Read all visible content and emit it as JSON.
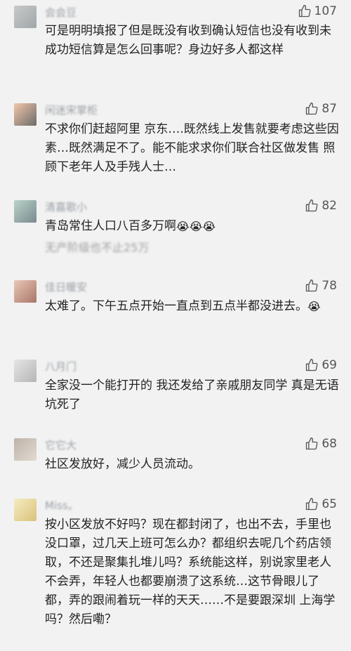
{
  "comments": [
    {
      "username": "会会豆",
      "likes": "107",
      "text": "可是明明填报了但是既没有收到确认短信也没有收到未成功短信算是怎么回事呢？身边好多人都这样"
    },
    {
      "username": "闲迷宋掌柜",
      "likes": "87",
      "text": "不求你们赶超阿里 京东….既然线上发售就要考虑这些因素…既然满足不了。能不能求求你们联合社区做发售 照顾下老年人及手残人士…"
    },
    {
      "username": "清嘉歌小",
      "likes": "82",
      "text": "青岛常住人口八百多万啊",
      "emojis": [
        "😭",
        "😭",
        "😭"
      ],
      "reply_preview": "无产阶级也不止25万"
    },
    {
      "username": "佳日暖安",
      "likes": "78",
      "text": "太难了。下午五点开始一直点到五点半都没进去。",
      "emojis": [
        "😭"
      ]
    },
    {
      "username": "八月门",
      "likes": "69",
      "text": "全家没一个能打开的 我还发给了亲戚朋友同学 真是无语 坑死了"
    },
    {
      "username": "它它大",
      "likes": "68",
      "text": "社区发放好，减少人员流动。"
    },
    {
      "username": "Miss。",
      "likes": "65",
      "text": "按小区发放不好吗？现在都封闭了，也出不去，手里也没口罩，过几天上班可怎么办？都组织去呢几个药店领取，不还是聚集扎堆儿吗？系统能这样，别说家里老人不会弄，年轻人也都要崩溃了这系统…这节骨眼儿了都，弄的跟闹着玩一样的天天……不是要跟深圳 上海学吗？然后嘞？"
    }
  ],
  "icons": {
    "like": "thumbs-up-icon",
    "avatar": "avatar"
  }
}
